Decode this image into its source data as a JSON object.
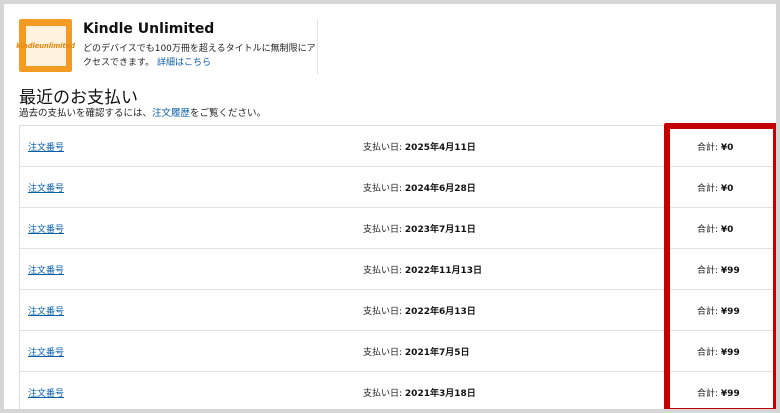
{
  "kindle_unlimited": {
    "logo_text": "kindleunlimited",
    "title": "Kindle Unlimited",
    "description": "どのデバイスでも100万冊を超えるタイトルに無制限にアクセスできます。",
    "details_link": "詳細はこちら"
  },
  "payments": {
    "heading": "最近のお支払い",
    "subtext_before": "過去の支払いを確認するには、",
    "order_history_link": "注文履歴",
    "subtext_after": "をご覧ください。",
    "rows": [
      {
        "order_label": "注文番号",
        "date_label": "支払い日:",
        "date": "2025年4月11日",
        "total_label": "合計:",
        "total": "¥0"
      },
      {
        "order_label": "注文番号",
        "date_label": "支払い日:",
        "date": "2024年6月28日",
        "total_label": "合計:",
        "total": "¥0"
      },
      {
        "order_label": "注文番号",
        "date_label": "支払い日:",
        "date": "2023年7月11日",
        "total_label": "合計:",
        "total": "¥0"
      },
      {
        "order_label": "注文番号",
        "date_label": "支払い日:",
        "date": "2022年11月13日",
        "total_label": "合計:",
        "total": "¥99"
      },
      {
        "order_label": "注文番号",
        "date_label": "支払い日:",
        "date": "2022年6月13日",
        "total_label": "合計:",
        "total": "¥99"
      },
      {
        "order_label": "注文番号",
        "date_label": "支払い日:",
        "date": "2021年7月5日",
        "total_label": "合計:",
        "total": "¥99"
      },
      {
        "order_label": "注文番号",
        "date_label": "支払い日:",
        "date": "2021年3月18日",
        "total_label": "合計:",
        "total": "¥99"
      }
    ]
  },
  "colors": {
    "link": "#0a5ea8",
    "highlight": "#c50000",
    "logo_orange": "#f39b22"
  }
}
